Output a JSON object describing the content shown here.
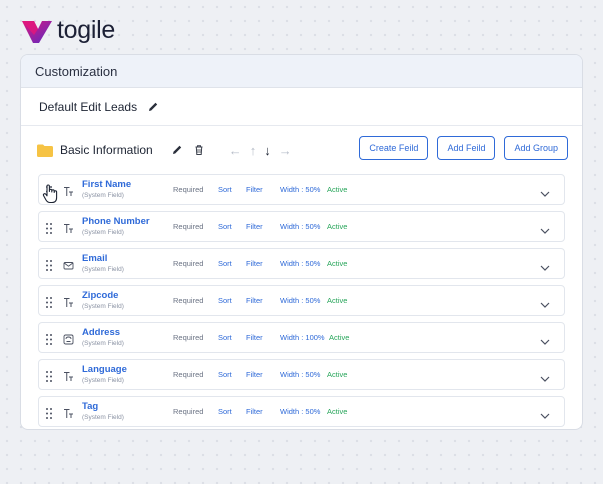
{
  "brand": {
    "name": "togile"
  },
  "panel": {
    "title": "Customization"
  },
  "subheader": {
    "title": "Default Edit Leads"
  },
  "group": {
    "title": "Basic Information",
    "buttons": {
      "create_field": "Create Feild",
      "add_field": "Add Feild",
      "add_group": "Add Group"
    }
  },
  "fields": [
    {
      "name": "First Name",
      "sub": "(System Field)",
      "icon": "text-type-icon",
      "required": "Required",
      "sort": "Sort",
      "filter": "Filter",
      "width": "Width : 50%",
      "status": "Active"
    },
    {
      "name": "Phone Number",
      "sub": "(System Field)",
      "icon": "text-type-icon",
      "required": "Required",
      "sort": "Sort",
      "filter": "Filter",
      "width": "Width : 50%",
      "status": "Active"
    },
    {
      "name": "Email",
      "sub": "(System Field)",
      "icon": "email-icon",
      "required": "Required",
      "sort": "Sort",
      "filter": "Filter",
      "width": "Width : 50%",
      "status": "Active"
    },
    {
      "name": "Zipcode",
      "sub": "(System Field)",
      "icon": "text-type-icon",
      "required": "Required",
      "sort": "Sort",
      "filter": "Filter",
      "width": "Width : 50%",
      "status": "Active"
    },
    {
      "name": "Address",
      "sub": "(System Field)",
      "icon": "address-icon",
      "required": "Required",
      "sort": "Sort",
      "filter": "Filter",
      "width": "Width : 100%",
      "status": "Active"
    },
    {
      "name": "Language",
      "sub": "(System Field)",
      "icon": "text-type-icon",
      "required": "Required",
      "sort": "Sort",
      "filter": "Filter",
      "width": "Width : 50%",
      "status": "Active"
    },
    {
      "name": "Tag",
      "sub": "(System Field)",
      "icon": "text-type-icon",
      "required": "Required",
      "sort": "Sort",
      "filter": "Filter",
      "width": "Width : 50%",
      "status": "Active"
    }
  ],
  "colors": {
    "accent": "#2f6ad8",
    "active": "#27a55a",
    "logo_magenta": "#e0177d",
    "logo_purple": "#5a2bc2"
  }
}
